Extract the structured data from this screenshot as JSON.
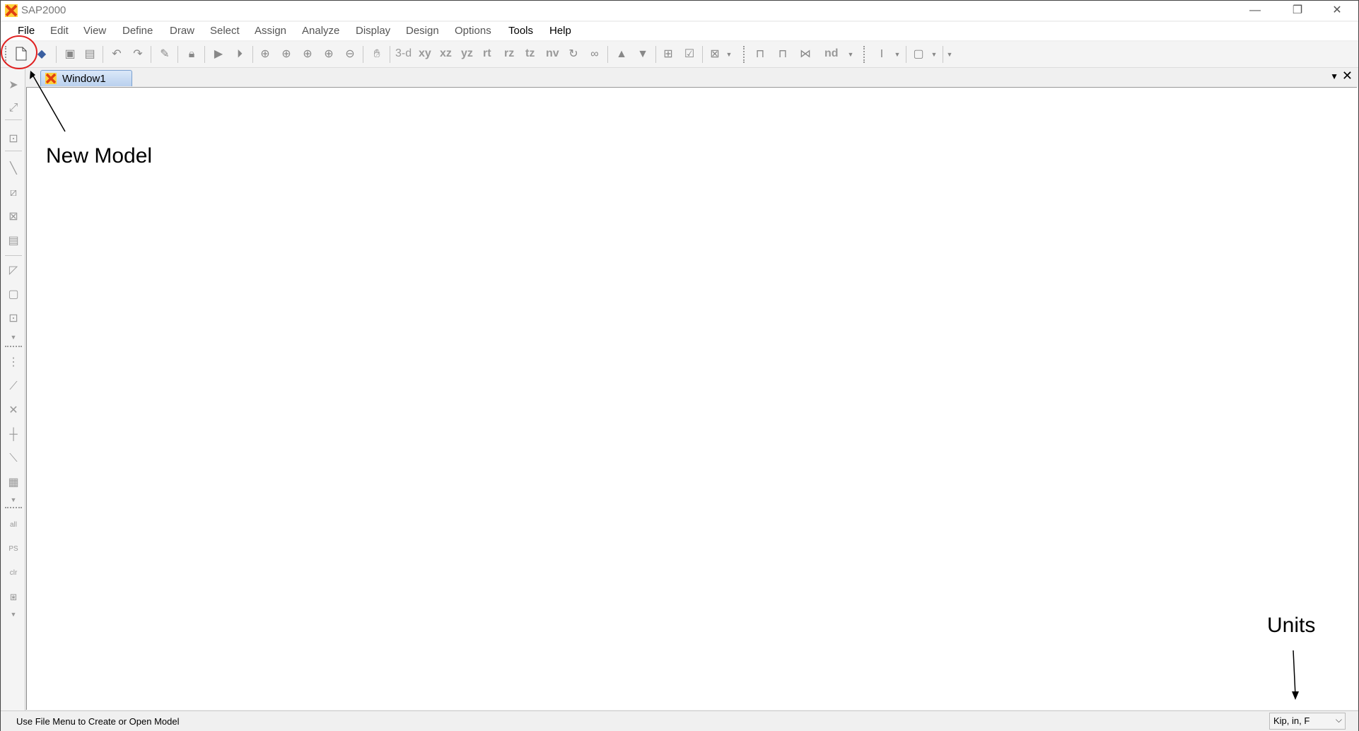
{
  "app": {
    "title": "SAP2000"
  },
  "window_controls": {
    "minimize": "—",
    "restore": "❐",
    "close": "✕"
  },
  "menu": [
    "File",
    "Edit",
    "View",
    "Define",
    "Draw",
    "Select",
    "Assign",
    "Analyze",
    "Display",
    "Design",
    "Options",
    "Tools",
    "Help"
  ],
  "toolbar": {
    "view_labels": [
      "3-d",
      "xy",
      "xz",
      "yz",
      "rt",
      "rz",
      "tz",
      "nv"
    ],
    "nd_label": "nd"
  },
  "tab": {
    "label": "Window1"
  },
  "status": {
    "message": "Use File Menu to Create or Open Model",
    "units": "Kip, in, F"
  },
  "annotations": {
    "new_model": "New Model",
    "units": "Units"
  },
  "colors": {
    "annotation_circle": "#e02020",
    "tab_active": "#b9d0ee",
    "logo": "#e04010"
  },
  "icons": [
    "new-model-icon",
    "open-icon",
    "save-icon",
    "print-icon",
    "undo-icon",
    "redo-icon",
    "pencil-icon",
    "lock-icon",
    "run-icon",
    "run-step-icon",
    "zoom-rubber-icon",
    "zoom-restore-icon",
    "zoom-previous-icon",
    "zoom-in-icon",
    "zoom-out-icon",
    "pan-icon",
    "rotate-icon",
    "perspective-icon",
    "up-icon",
    "down-icon",
    "object-shrink-icon",
    "check-icon",
    "display-options-icon",
    "frame-icon",
    "portal-frame-icon",
    "truss-icon",
    "text-cursor-icon",
    "shading-icon"
  ]
}
